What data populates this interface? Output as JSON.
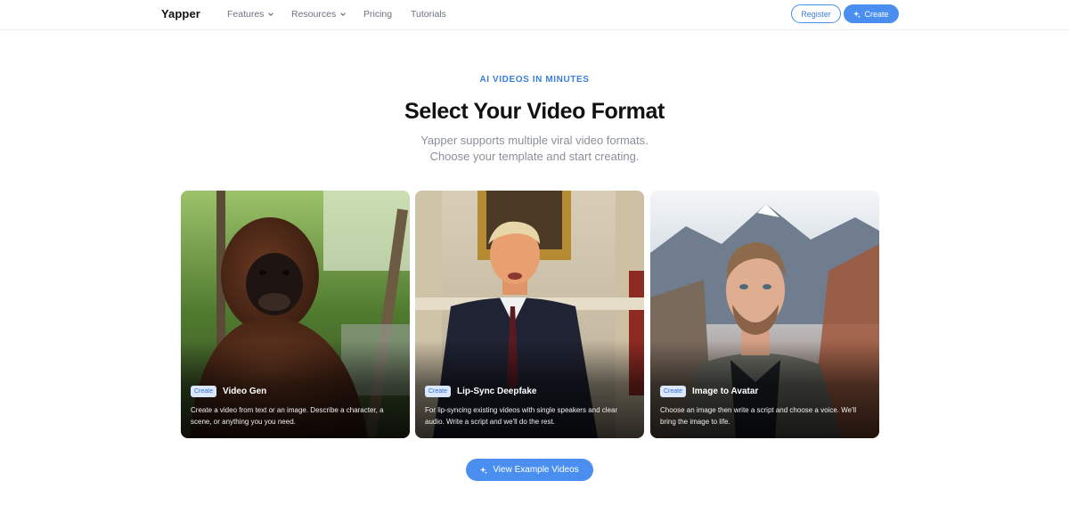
{
  "nav": {
    "logo": "Yapper",
    "items": [
      {
        "label": "Features",
        "has_dropdown": true
      },
      {
        "label": "Resources",
        "has_dropdown": true
      },
      {
        "label": "Pricing",
        "has_dropdown": false
      },
      {
        "label": "Tutorials",
        "has_dropdown": false
      }
    ],
    "register_label": "Register",
    "create_label": "Create"
  },
  "hero": {
    "eyebrow": "AI VIDEOS IN MINUTES",
    "title": "Select Your Video Format",
    "subtitle_line1": "Yapper supports multiple viral video formats.",
    "subtitle_line2": "Choose your template and start creating."
  },
  "cards": [
    {
      "badge": "Create",
      "title": "Video Gen",
      "description": "Create a video from text or an image. Describe a character, a scene, or anything you you need."
    },
    {
      "badge": "Create",
      "title": "Lip-Sync Deepfake",
      "description": "For lip-syncing existing videos with single speakers and clear audio. Write a script and we'll do the rest."
    },
    {
      "badge": "Create",
      "title": "Image to Avatar",
      "description": "Choose an image then write a script and choose a voice. We'll bring the image to life."
    }
  ],
  "cta": {
    "label": "View Example Videos"
  },
  "colors": {
    "accent": "#4a8ff0",
    "accent_text": "#3b7fd9",
    "muted": "#8a8f98",
    "heading": "#111111"
  }
}
